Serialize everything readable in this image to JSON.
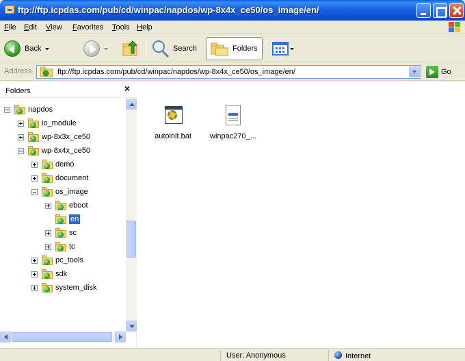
{
  "window": {
    "title": "ftp://ftp.icpdas.com/pub/cd/winpac/napdos/wp-8x4x_ce50/os_image/en/"
  },
  "menu": [
    "File",
    "Edit",
    "View",
    "Favorites",
    "Tools",
    "Help"
  ],
  "toolbar": {
    "back_label": "Back",
    "search_label": "Search",
    "folders_label": "Folders"
  },
  "address": {
    "label": "Address",
    "value": "ftp://ftp.icpdas.com/pub/cd/winpac/napdos/wp-8x4x_ce50/os_image/en/",
    "go_label": "Go"
  },
  "folders_pane": {
    "title": "Folders",
    "close_glyph": "×",
    "tree": [
      {
        "label": "napdos",
        "level": 0,
        "expander": "minus"
      },
      {
        "label": "io_module",
        "level": 1,
        "expander": "plus"
      },
      {
        "label": "wp-8x3x_ce50",
        "level": 1,
        "expander": "plus"
      },
      {
        "label": "wp-8x4x_ce50",
        "level": 1,
        "expander": "minus"
      },
      {
        "label": "demo",
        "level": 2,
        "expander": "plus"
      },
      {
        "label": "document",
        "level": 2,
        "expander": "plus"
      },
      {
        "label": "os_image",
        "level": 2,
        "expander": "minus"
      },
      {
        "label": "eboot",
        "level": 3,
        "expander": "plus"
      },
      {
        "label": "en",
        "level": 3,
        "expander": "none",
        "selected": true
      },
      {
        "label": "sc",
        "level": 3,
        "expander": "plus"
      },
      {
        "label": "tc",
        "level": 3,
        "expander": "plus"
      },
      {
        "label": "pc_tools",
        "level": 2,
        "expander": "plus"
      },
      {
        "label": "sdk",
        "level": 2,
        "expander": "plus"
      },
      {
        "label": "system_disk",
        "level": 2,
        "expander": "plus"
      }
    ]
  },
  "files": [
    {
      "name": "autoinit.bat",
      "icon": "batch-file-icon"
    },
    {
      "name": "winpac270_...",
      "icon": "text-file-icon"
    }
  ],
  "status": {
    "user": "User: Anonymous",
    "zone": "Internet"
  }
}
